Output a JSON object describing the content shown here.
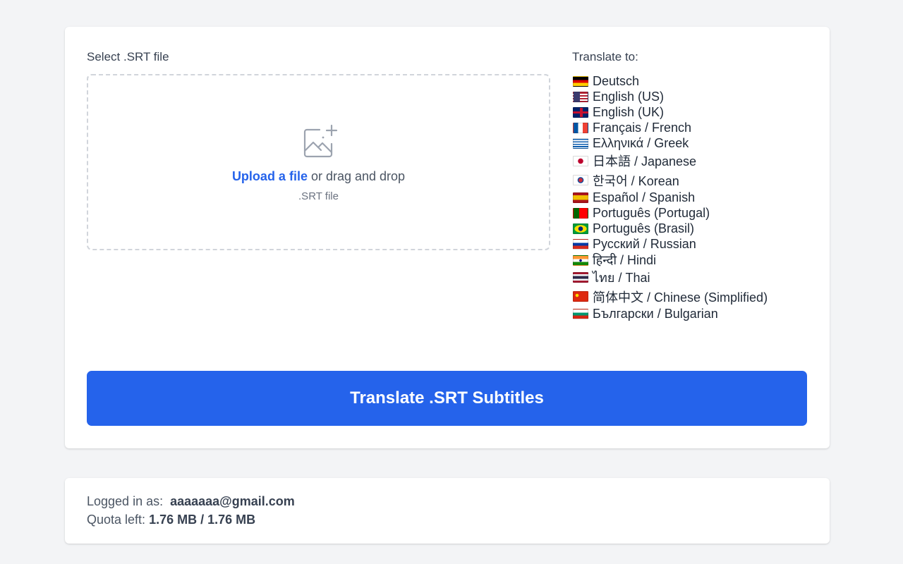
{
  "upload": {
    "label": "Select .SRT file",
    "link_text": "Upload a file",
    "drag_text": " or drag and drop",
    "hint": ".SRT file",
    "icon": "photo-plus-icon"
  },
  "languages": {
    "label": "Translate to:",
    "items": [
      {
        "flag": "flag-de",
        "label": "Deutsch"
      },
      {
        "flag": "flag-us",
        "label": "English (US)"
      },
      {
        "flag": "flag-gb",
        "label": "English (UK)"
      },
      {
        "flag": "flag-fr",
        "label": "Français / French"
      },
      {
        "flag": "flag-gr",
        "label": "Ελληνικά / Greek"
      },
      {
        "flag": "flag-jp",
        "label": "日本語 / Japanese"
      },
      {
        "flag": "flag-kr",
        "label": "한국어 / Korean"
      },
      {
        "flag": "flag-es",
        "label": "Español / Spanish"
      },
      {
        "flag": "flag-pt",
        "label": "Português (Portugal)"
      },
      {
        "flag": "flag-br",
        "label": "Português (Brasil)"
      },
      {
        "flag": "flag-ru",
        "label": "Русский / Russian"
      },
      {
        "flag": "flag-in",
        "label": "हिन्दी / Hindi"
      },
      {
        "flag": "flag-th",
        "label": "ไทย / Thai"
      },
      {
        "flag": "flag-cn",
        "label": "简体中文 / Chinese (Simplified)"
      },
      {
        "flag": "flag-bg",
        "label": "Български / Bulgarian"
      }
    ]
  },
  "translate_button": "Translate .SRT Subtitles",
  "account": {
    "logged_in_label": "Logged in as:",
    "email": "aaaaaaa@gmail.com",
    "quota_label": "Quota left:",
    "quota_value": "1.76 MB / 1.76 MB"
  },
  "colors": {
    "accent": "#2563eb",
    "background": "#f3f4f6",
    "card": "#ffffff"
  }
}
